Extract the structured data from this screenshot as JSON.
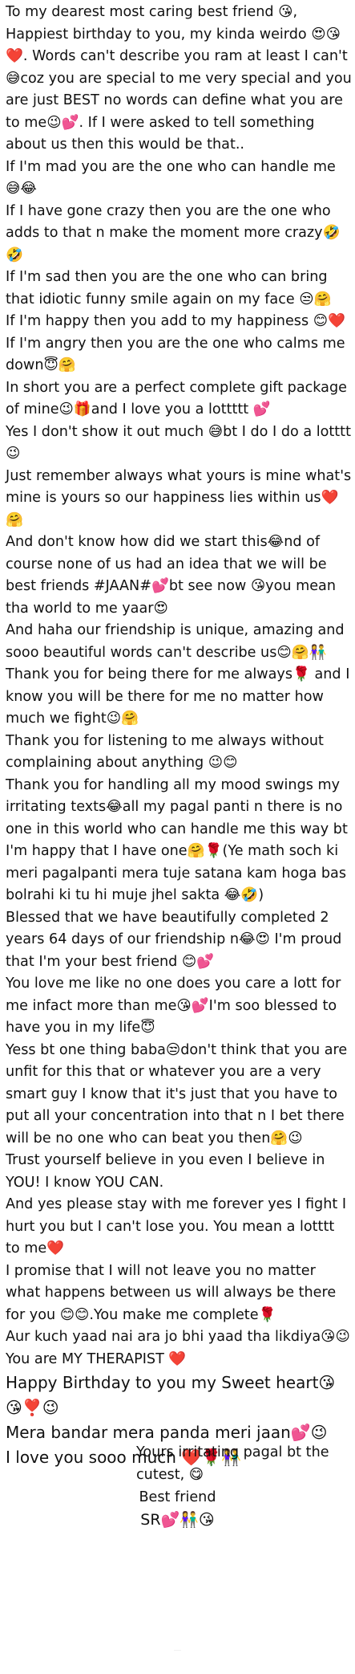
{
  "paragraphs": [
    "To my dearest most caring best friend 😘, Happiest birthday to you, my kinda weirdo 😍😘❤️. Words can't describe you ram at least I can't 😅coz you are special to me very special and you are just BEST no words can define what you are to me😉💕. If I were asked to tell something about us then this would be that..",
    "    If I'm mad you are the one who can handle me 😅😂",
    "    If I have gone crazy then you are the one who adds to that n make the moment more crazy🤣🤣",
    "    If I'm sad then you are the one who can bring that idiotic funny smile again on my face 😒🤗",
    "    If I'm happy then you add to my happiness 😊❤️",
    "    If I'm angry then you are the one who calms me down😇🤗",
    "  In short you are a perfect complete gift package of mine😉🎁and I love you a lottttt 💕",
    "  Yes I don't show it out much  😅bt I do I do a lotttt 😉",
    "  Just remember always what yours is mine what's mine is yours so our happiness lies within us❤️🤗",
    "  And don't know how did we start this😂nd of course none of us had an idea that we will be best friends #JAAN#💕bt see now 😘you mean tha world to me yaar😍",
    "  And haha our friendship is unique, amazing and sooo beautiful words can't describe us😊🤗👫",
    "  Thank you for being there for me always🌹 and I know you will be there for me no matter how much we fight😉🤗",
    "  Thank you for listening to me always without complaining about anything 😉😊",
    "  Thank you for handling all my mood swings my irritating texts😂all my pagal panti n there is no one in this world who can handle me this way bt I'm happy that I have one🤗🌹(Ye math soch ki meri pagalpanti mera tuje satana kam hoga bas bolrahi ki tu hi muje jhel sakta 😂🤣)",
    "  Blessed that we have beautifully completed 2 years 64 days of our friendship n😂😍 I'm proud that I'm your best friend 😊💕",
    "  You love me like no one does you care a lott for me infact more than me😘💕I'm soo blessed to have you in my life😇",
    "  Yess bt one thing baba😒don't think that you are unfit for this that or whatever you are a very smart guy I know that it's just that you have  to put all your concentration into that n I bet there will be no one who can beat you then🤗😉",
    "  Trust yourself believe in you even I believe in YOU! I know YOU CAN.",
    "  And yes please stay with me forever yes I fight I hurt you but I can't lose you. You mean a lotttt to me❤️",
    "  I promise that I will not leave you no matter what happens between us will always be there for you 😊😊.You make me complete🌹",
    "  Aur kuch yaad nai ara jo bhi yaad tha likdiya😘😉",
    "  You are MY THERAPIST ❤️"
  ],
  "big_paragraphs": [
    "   Happy Birthday to you my Sweet heart😘😘❣️😉",
    "   Mera bandar mera panda meri jaan💕😉",
    "   I love you sooo much ❤️🌹👫"
  ],
  "signature": {
    "closing": "Yours irritating pagal bt the cutest, 😋",
    "role": "Best friend",
    "name": "SR💕👫😘"
  },
  "watermark": "—"
}
